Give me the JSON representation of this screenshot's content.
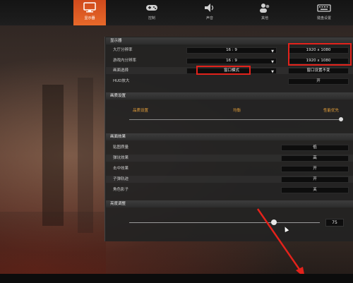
{
  "nav": {
    "items": [
      {
        "label": "显示器",
        "icon": "monitor-icon",
        "active": true
      },
      {
        "label": "控制",
        "icon": "gamepad-icon",
        "active": false
      },
      {
        "label": "声音",
        "icon": "speaker-icon",
        "active": false
      },
      {
        "label": "其他",
        "icon": "people-icon",
        "active": false
      },
      {
        "label": "键盘设置",
        "icon": "keyboard-icon",
        "active": false
      }
    ]
  },
  "display": {
    "header": "显示器",
    "rows": [
      {
        "label": "大厅分辨率",
        "value": "16 : 9",
        "extra": "1920 x 1080"
      },
      {
        "label": "游戏内分辨率",
        "value": "16 : 9",
        "extra": "1920 x 1080"
      },
      {
        "label": "画面选择",
        "value": "窗口模式",
        "extra": "窗口设置不变"
      },
      {
        "label": "HUD放大",
        "value": "",
        "extra": "开"
      }
    ]
  },
  "quality": {
    "header": "画质设置",
    "low": "品质设置",
    "mid": "均衡",
    "high": "性能优先"
  },
  "effects": {
    "header": "画面效果",
    "rows": [
      {
        "label": "贴图质量",
        "value": "低"
      },
      {
        "label": "弹坑效果",
        "value": "高"
      },
      {
        "label": "击中效果",
        "value": "开"
      },
      {
        "label": "子弹轨迹",
        "value": "开"
      },
      {
        "label": "角色影子",
        "value": "关"
      }
    ]
  },
  "volume": {
    "header": "亮度调整",
    "value": "75",
    "level": 0.75
  },
  "colors": {
    "accent": "#e8692a",
    "highlight": "#e3221b",
    "quality_text": "#e8a23a"
  }
}
